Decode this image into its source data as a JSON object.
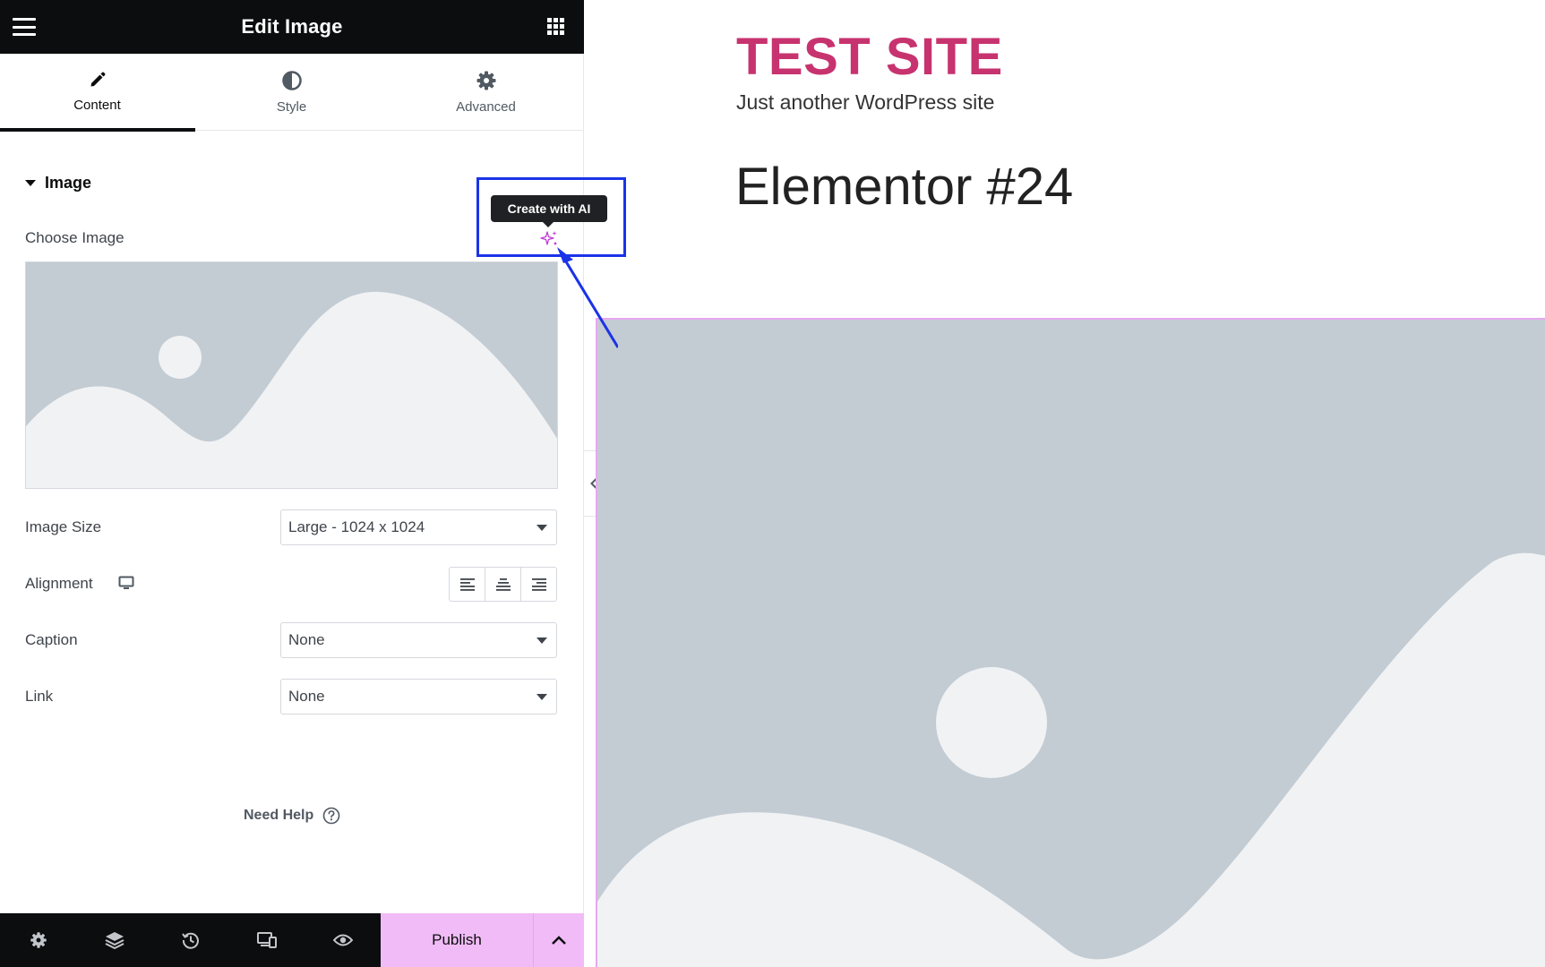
{
  "panel": {
    "title": "Edit Image",
    "tabs": [
      {
        "label": "Content",
        "icon": "pencil-icon",
        "active": true
      },
      {
        "label": "Style",
        "icon": "half-circle-icon",
        "active": false
      },
      {
        "label": "Advanced",
        "icon": "gear-icon",
        "active": false
      }
    ],
    "section_title": "Image",
    "choose_image_label": "Choose Image",
    "ai_tooltip": "Create with AI",
    "fields": {
      "image_size": {
        "label": "Image Size",
        "value": "Large - 1024 x 1024"
      },
      "alignment": {
        "label": "Alignment"
      },
      "caption": {
        "label": "Caption",
        "value": "None"
      },
      "link": {
        "label": "Link",
        "value": "None"
      }
    },
    "need_help": "Need Help",
    "footer": {
      "icons": [
        "gear-icon",
        "layers-icon",
        "history-icon",
        "responsive-icon",
        "eye-icon"
      ],
      "publish_label": "Publish"
    }
  },
  "preview": {
    "site_title": "TEST SITE",
    "tagline": "Just another WordPress site",
    "page_title": "Elementor #24"
  },
  "colors": {
    "site_title": "#c7336f",
    "publish_bg": "#f0bbf6",
    "annotation_blue": "#1a33e8",
    "placeholder_bg": "#c3cbd3",
    "placeholder_fg": "#f0f2f4"
  }
}
